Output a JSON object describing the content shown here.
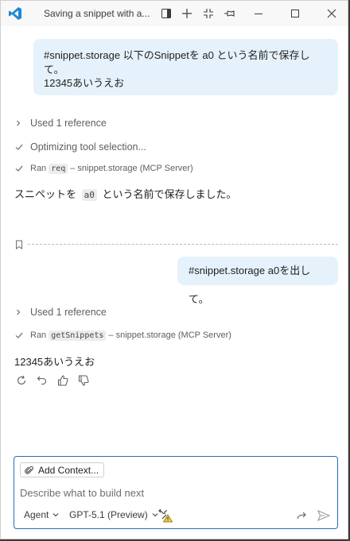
{
  "window": {
    "title": "Saving a snippet with a...",
    "accent": "#2b6cb8",
    "bubble_color": "#e6f2fb"
  },
  "titlebar_icons": [
    "vscode-logo-icon",
    "open-in-editor-icon",
    "new-chat-icon",
    "collapse-icon",
    "pin-icon",
    "minimize-icon",
    "maximize-icon",
    "close-icon"
  ],
  "chat": {
    "turn1": {
      "user_line1": "#snippet.storage 以下のSnippetを a0 という名前で保存して。",
      "user_line2": "12345あいうえお",
      "references": "Used 1 reference",
      "optimizing": "Optimizing tool selection...",
      "ran_prefix": "Ran",
      "ran_tool": "req",
      "ran_suffix": "– snippet.storage (MCP Server)",
      "answer_pre": "スニペットを",
      "answer_code": "a0",
      "answer_post": "という名前で保存しました。"
    },
    "turn2": {
      "user_text": "#snippet.storage a0を出して。",
      "references": "Used 1 reference",
      "ran_prefix": "Ran",
      "ran_tool": "getSnippets",
      "ran_suffix": "– snippet.storage (MCP Server)",
      "answer": "12345あいうえお"
    }
  },
  "input": {
    "add_context": "Add Context...",
    "placeholder": "Describe what to build next",
    "mode": "Agent",
    "model": "GPT-5.1 (Preview)"
  }
}
